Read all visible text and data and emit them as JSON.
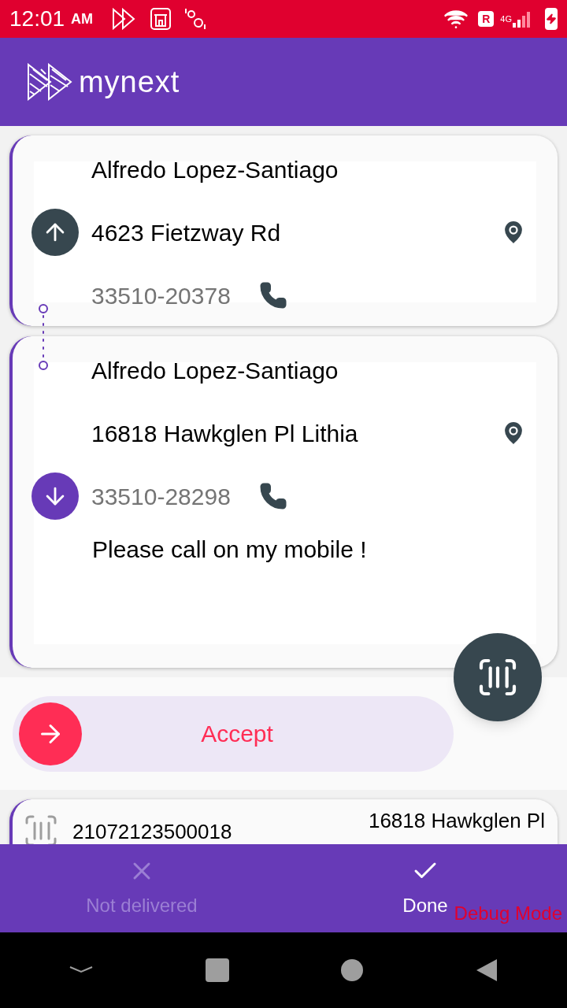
{
  "status_bar": {
    "time": "12:01",
    "ampm": "AM",
    "carrier_badge": "R",
    "network": "4G"
  },
  "app_bar": {
    "logo_text": "mynext"
  },
  "stops": [
    {
      "kind": "pickup",
      "name": "Alfredo Lopez-Santiago",
      "address": "4623 Fietzway Rd",
      "phone": "33510-20378"
    },
    {
      "kind": "drop",
      "name": "Alfredo Lopez-Santiago",
      "address": "16818 Hawkglen Pl Lithia",
      "phone": "33510-28298",
      "note": "Please call on my mobile !"
    }
  ],
  "accept": {
    "label": "Accept"
  },
  "parcel": {
    "barcode": "21072123500018",
    "address": "16818 Hawkglen Pl"
  },
  "actions": [
    {
      "kind": "close",
      "label": "Not delivered",
      "disabled": true
    },
    {
      "kind": "check",
      "label": "Done",
      "disabled": false
    }
  ],
  "debug_label": "Debug Mode"
}
